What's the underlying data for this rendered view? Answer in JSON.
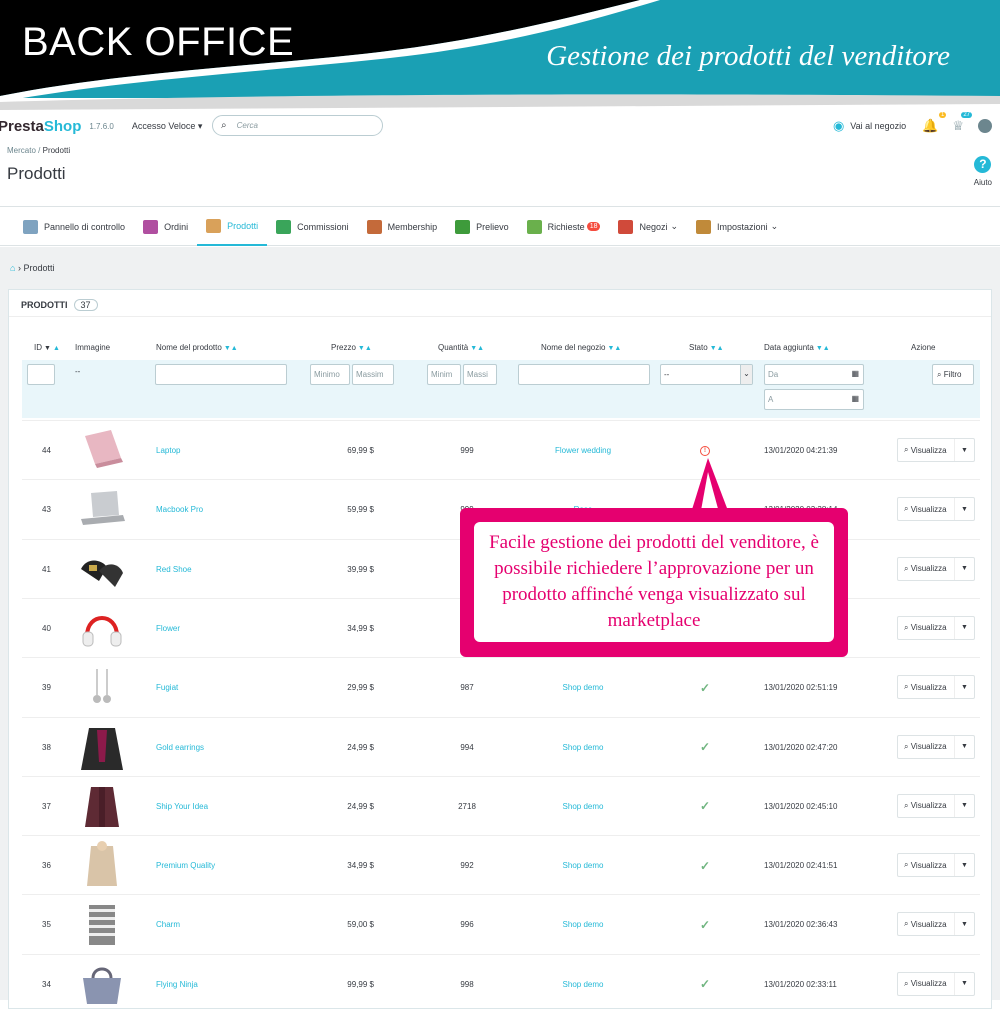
{
  "banner": {
    "left_title": "BACK OFFICE",
    "right_title": "Gestione dei prodotti del venditore"
  },
  "topbar": {
    "logo_a": "Presta",
    "logo_b": "Shop",
    "version": "1.7.6.0",
    "quick_access": "Accesso Veloce ▾",
    "search_placeholder": "Cerca",
    "shop_link": "Vai al negozio",
    "notif_orders": "1",
    "notif_customers": "27"
  },
  "breadcrumb": {
    "parent": "Mercato",
    "sep": "/",
    "current": "Prodotti"
  },
  "page_title": "Prodotti",
  "help_label": "Aiuto",
  "nav": [
    {
      "label": "Pannello di controllo",
      "icon": "dashboard-icon",
      "color": "#7fa3c0"
    },
    {
      "label": "Ordini",
      "icon": "cart-icon",
      "color": "#b04fa0"
    },
    {
      "label": "Prodotti",
      "icon": "box-icon",
      "color": "#d9a15a",
      "active": true
    },
    {
      "label": "Commissioni",
      "icon": "money-icon",
      "color": "#3aa55a"
    },
    {
      "label": "Membership",
      "icon": "card-icon",
      "color": "#c46a3a"
    },
    {
      "label": "Prelievo",
      "icon": "withdraw-icon",
      "color": "#3e9b3b"
    },
    {
      "label": "Richieste",
      "icon": "check-icon",
      "color": "#6ab04c",
      "badge": "18"
    },
    {
      "label": "Negozi",
      "icon": "store-icon",
      "color": "#d04a3a",
      "dropdown": "⌄"
    },
    {
      "label": "Impostazioni",
      "icon": "gear-icon",
      "color": "#c08a3a",
      "dropdown": "⌄"
    }
  ],
  "breadcrumb2": "Prodotti",
  "panel": {
    "title": "PRODOTTI",
    "count": "37"
  },
  "columns": {
    "id": "ID",
    "image": "Immagine",
    "name": "Nome del prodotto",
    "price": "Prezzo",
    "qty": "Quantità",
    "shop": "Nome del negozio",
    "status": "Stato",
    "date": "Data aggiunta",
    "action": "Azione"
  },
  "filters": {
    "img_dash": "--",
    "price_min": "Minimo",
    "price_max": "Massim",
    "qty_min": "Minim",
    "qty_max": "Massi",
    "status_select": "--",
    "date_from": "Da",
    "date_to": "A",
    "filter_btn": "Filtro"
  },
  "view_label": "Visualizza",
  "rows": [
    {
      "id": "44",
      "name": "Laptop",
      "price": "69,99 $",
      "qty": "999",
      "shop": "Flower wedding",
      "status": "pending",
      "date": "13/01/2020 04:21:39",
      "img": "laptop-pink"
    },
    {
      "id": "43",
      "name": "Macbook Pro",
      "price": "59,99 $",
      "qty": "999",
      "shop": "Rose",
      "status": "approved",
      "date": "13/01/2020 03:38:14",
      "img": "laptop-silver"
    },
    {
      "id": "41",
      "name": "Red Shoe",
      "price": "39,99 $",
      "qty": "999",
      "shop": "",
      "status": "",
      "date": "",
      "img": "shoes"
    },
    {
      "id": "40",
      "name": "Flower",
      "price": "34,99 $",
      "qty": "999",
      "shop": "",
      "status": "",
      "date": "",
      "img": "headphones"
    },
    {
      "id": "39",
      "name": "Fugiat",
      "price": "29,99 $",
      "qty": "987",
      "shop": "Shop demo",
      "status": "approved",
      "date": "13/01/2020 02:51:19",
      "img": "earrings"
    },
    {
      "id": "38",
      "name": "Gold earrings",
      "price": "24,99 $",
      "qty": "994",
      "shop": "Shop demo",
      "status": "approved",
      "date": "13/01/2020 02:47:20",
      "img": "jacket"
    },
    {
      "id": "37",
      "name": "Ship Your Idea",
      "price": "24,99 $",
      "qty": "2718",
      "shop": "Shop demo",
      "status": "approved",
      "date": "13/01/2020 02:45:10",
      "img": "cardigan"
    },
    {
      "id": "36",
      "name": "Premium Quality",
      "price": "34,99 $",
      "qty": "992",
      "shop": "Shop demo",
      "status": "approved",
      "date": "13/01/2020 02:41:51",
      "img": "sweater"
    },
    {
      "id": "35",
      "name": "Charm",
      "price": "59,00 $",
      "qty": "996",
      "shop": "Shop demo",
      "status": "approved",
      "date": "13/01/2020 02:36:43",
      "img": "stripes"
    },
    {
      "id": "34",
      "name": "Flying Ninja",
      "price": "99,99 $",
      "qty": "998",
      "shop": "Shop demo",
      "status": "approved",
      "date": "13/01/2020 02:33:11",
      "img": "bag"
    }
  ],
  "callout": "Facile gestione dei prodotti del venditore, è possibile richiedere l’approvazione per un prodotto affinché venga visualizzato sul marketplace",
  "colors": {
    "accent": "#25b9d7",
    "banner_teal": "#1aa0b4",
    "callout": "#e5006f"
  }
}
